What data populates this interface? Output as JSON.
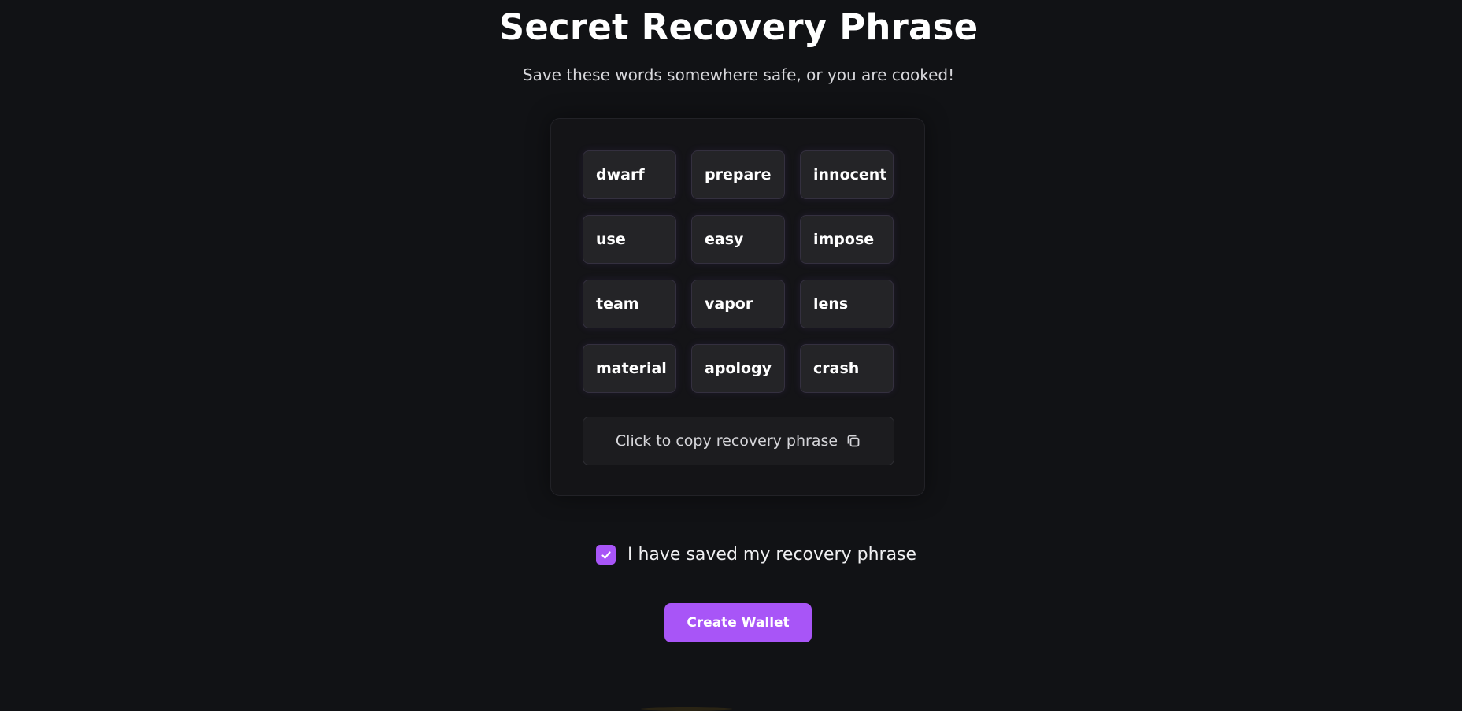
{
  "header": {
    "title": "Secret Recovery Phrase",
    "subtitle": "Save these words somewhere safe, or you are cooked!"
  },
  "phrase": {
    "words": [
      "dwarf",
      "prepare",
      "innocent",
      "use",
      "easy",
      "impose",
      "team",
      "vapor",
      "lens",
      "material",
      "apology",
      "crash"
    ],
    "copy_label": "Click to copy recovery phrase",
    "copy_icon": "copy-icon"
  },
  "confirm": {
    "label": "I have saved my recovery phrase",
    "checked": true,
    "icon": "checkmark-icon"
  },
  "actions": {
    "create_label": "Create Wallet"
  },
  "colors": {
    "background": "#111215",
    "card": "#141417",
    "word_tile": "#242427",
    "accent": "#a855f7"
  }
}
